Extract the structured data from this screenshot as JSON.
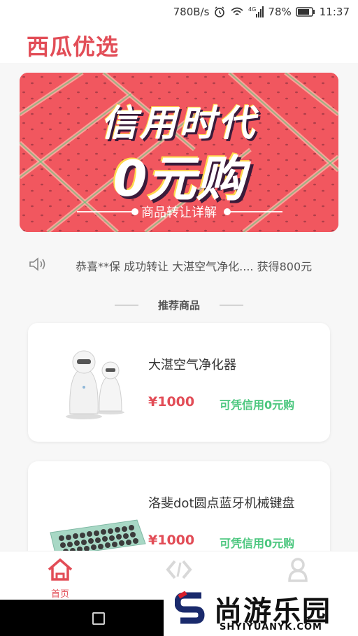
{
  "statusbar": {
    "speed": "780B/s",
    "network": "4G",
    "battery": "78%",
    "time": "11:37",
    "icons": [
      "alarm-icon",
      "wifi-icon",
      "signal-icon",
      "battery-icon"
    ]
  },
  "app": {
    "title": "西瓜优选"
  },
  "banner": {
    "line1": "信用时代",
    "line2": "0元购",
    "link": "商品转让详解"
  },
  "notice": {
    "icon": "speaker-icon",
    "text": "恭喜**保 成功转让 大湛空气净化.... 获得800元"
  },
  "section": {
    "title": "推荐商品"
  },
  "products": [
    {
      "name": "大湛空气净化器",
      "price": "¥1000",
      "tag": "可凭信用0元购"
    },
    {
      "name": "洛斐dot圆点蓝牙机械键盘",
      "price": "¥1000",
      "tag": "可凭信用0元购"
    }
  ],
  "tabbar": {
    "items": [
      {
        "label": "首页",
        "icon": "home-icon",
        "active": true
      },
      {
        "label": "",
        "icon": "transfer-icon",
        "active": false
      },
      {
        "label": "",
        "icon": "user-icon",
        "active": false
      }
    ]
  },
  "watermark": {
    "title": "尚游乐园",
    "url": "SHYIYUANYK.COM"
  },
  "colors": {
    "accent": "#e24d57",
    "green": "#4cc77f",
    "banner": "#f1575f"
  }
}
